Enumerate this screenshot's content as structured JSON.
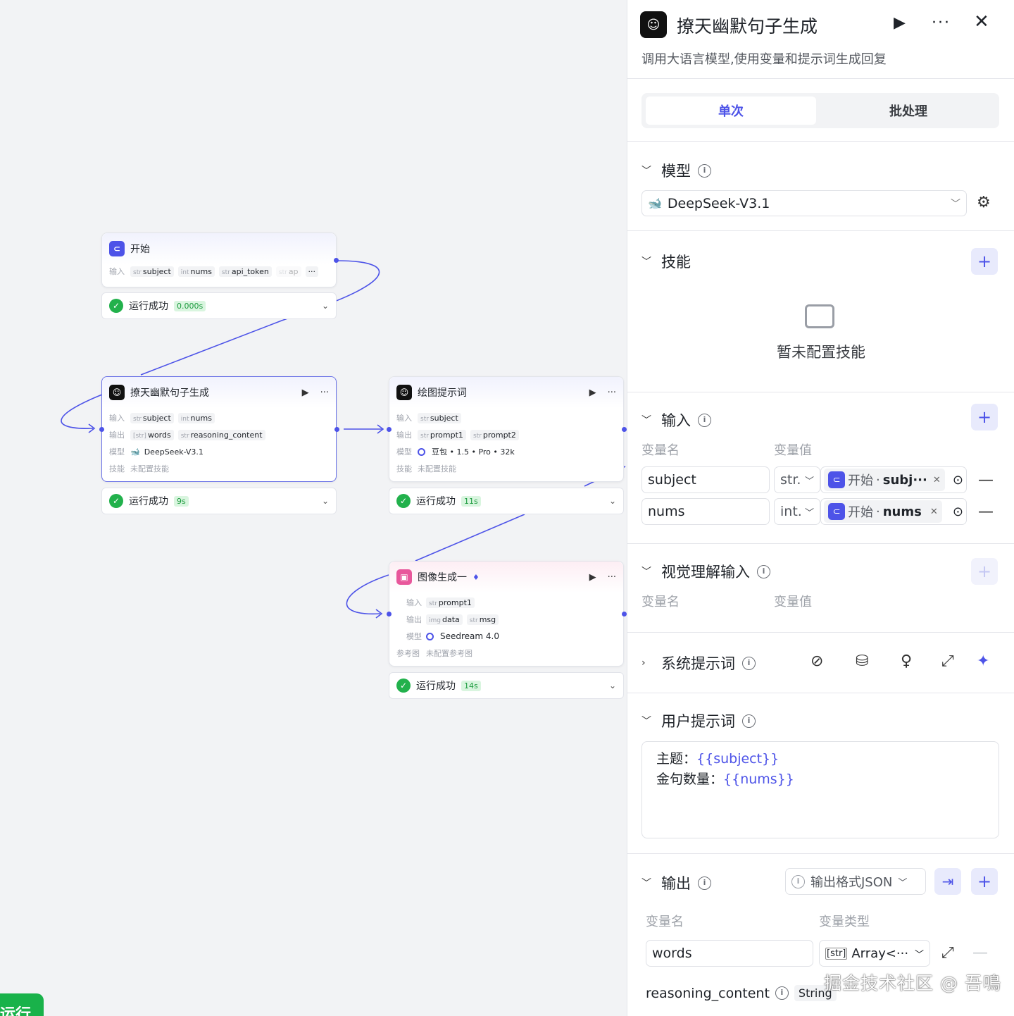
{
  "canvas": {
    "run_button_label": "运行",
    "nodes": {
      "start": {
        "title": "开始",
        "input_label": "输入",
        "inputs": [
          {
            "type": "str",
            "name": "subject"
          },
          {
            "type": "int",
            "name": "nums"
          },
          {
            "type": "str",
            "name": "api_token"
          },
          {
            "type": "str",
            "name": "ap"
          }
        ],
        "more": "···",
        "status": "运行成功",
        "time": "0.000s"
      },
      "joke": {
        "title": "撩天幽默句子生成",
        "input_label": "输入",
        "output_label": "输出",
        "model_label": "模型",
        "skill_label": "技能",
        "inputs": [
          {
            "type": "str",
            "name": "subject"
          },
          {
            "type": "int",
            "name": "nums"
          }
        ],
        "outputs": [
          {
            "type": "[str]",
            "name": "words"
          },
          {
            "type": "str",
            "name": "reasoning_content"
          }
        ],
        "model": "DeepSeek-V3.1",
        "skill": "未配置技能",
        "status": "运行成功",
        "time": "9s"
      },
      "draw": {
        "title": "绘图提示词",
        "input_label": "输入",
        "output_label": "输出",
        "model_label": "模型",
        "skill_label": "技能",
        "inputs": [
          {
            "type": "str",
            "name": "subject"
          }
        ],
        "outputs": [
          {
            "type": "str",
            "name": "prompt1"
          },
          {
            "type": "str",
            "name": "prompt2"
          }
        ],
        "model": "豆包 • 1.5 • Pro • 32k",
        "skill": "未配置技能",
        "status": "运行成功",
        "time": "11s"
      },
      "image": {
        "title": "图像生成一",
        "input_label": "输入",
        "output_label": "输出",
        "model_label": "模型",
        "ref_label": "参考图",
        "inputs": [
          {
            "type": "str",
            "name": "prompt1"
          }
        ],
        "outputs": [
          {
            "type": "img",
            "name": "data"
          },
          {
            "type": "str",
            "name": "msg"
          }
        ],
        "model": "Seedream 4.0",
        "ref": "未配置参考图",
        "status": "运行成功",
        "time": "14s"
      }
    }
  },
  "panel": {
    "title": "撩天幽默句子生成",
    "description": "调用大语言模型,使用变量和提示词生成回复",
    "tabs": [
      "单次",
      "批处理"
    ],
    "model": {
      "label": "模型",
      "selected": "DeepSeek-V3.1"
    },
    "skills": {
      "label": "技能",
      "empty": "暂未配置技能"
    },
    "inputs": {
      "label": "输入",
      "col_name": "变量名",
      "col_value": "变量值",
      "rows": [
        {
          "name": "subject",
          "type": "str.",
          "ref_node": "开始",
          "ref_var": "subj···"
        },
        {
          "name": "nums",
          "type": "int.",
          "ref_node": "开始",
          "ref_var": "nums"
        }
      ]
    },
    "vision": {
      "label": "视觉理解输入",
      "col_name": "变量名",
      "col_value": "变量值"
    },
    "system_prompt": {
      "label": "系统提示词"
    },
    "user_prompt": {
      "label": "用户提示词",
      "line1_prefix": "主题：",
      "line1_var": "{{subject}}",
      "line2_prefix": "金句数量：",
      "line2_var": "{{nums}}"
    },
    "output": {
      "label": "输出",
      "format": "输出格式JSON",
      "col_name": "变量名",
      "col_type": "变量类型",
      "rows": [
        {
          "name": "words",
          "type": "Array<···"
        },
        {
          "name": "reasoning_content",
          "type": "String"
        }
      ]
    }
  },
  "watermark": "掘金技术社区 @ 吾鳴",
  "colors": {
    "accent": "#4d53e8",
    "success": "#22b14c",
    "edge": "#4d53e8"
  }
}
